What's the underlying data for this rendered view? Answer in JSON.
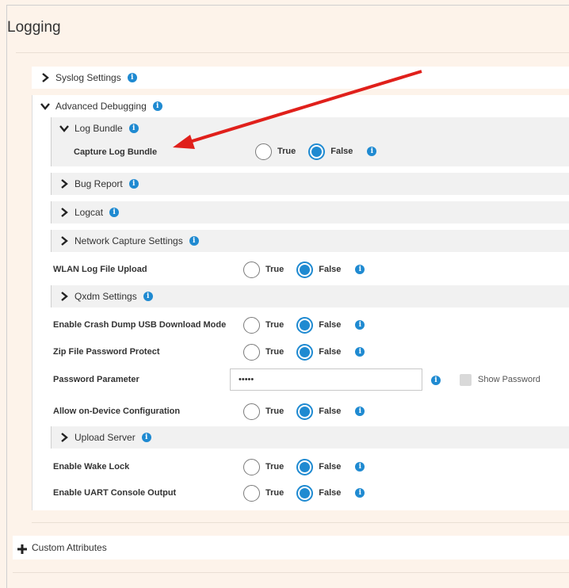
{
  "page": {
    "title": "Logging"
  },
  "sections": {
    "syslog": "Syslog Settings",
    "advanced": "Advanced Debugging",
    "log_bundle": "Log Bundle",
    "bug_report": "Bug Report",
    "logcat": "Logcat",
    "network_capture": "Network Capture Settings",
    "qxdm": "Qxdm Settings",
    "upload_server": "Upload Server",
    "custom_attributes": "Custom Attributes"
  },
  "fields": {
    "capture_log_bundle": {
      "label": "Capture Log Bundle",
      "value": "False"
    },
    "wlan_log_upload": {
      "label": "WLAN Log File Upload",
      "value": "False"
    },
    "crash_dump": {
      "label": "Enable Crash Dump USB Download Mode",
      "value": "False"
    },
    "zip_password": {
      "label": "Zip File Password Protect",
      "value": "False"
    },
    "password_param": {
      "label": "Password Parameter",
      "value": "•••••"
    },
    "allow_config": {
      "label": "Allow on-Device Configuration",
      "value": "False"
    },
    "wake_lock": {
      "label": "Enable Wake Lock",
      "value": "False"
    },
    "uart_console": {
      "label": "Enable UART Console Output",
      "value": "False"
    }
  },
  "options": {
    "true_label": "True",
    "false_label": "False"
  },
  "show_password": {
    "label": "Show Password",
    "checked": false
  },
  "info_glyph": "i",
  "colors": {
    "accent": "#1f8ad1",
    "arrow": "#e0201b",
    "background": "#fdf3ea"
  }
}
